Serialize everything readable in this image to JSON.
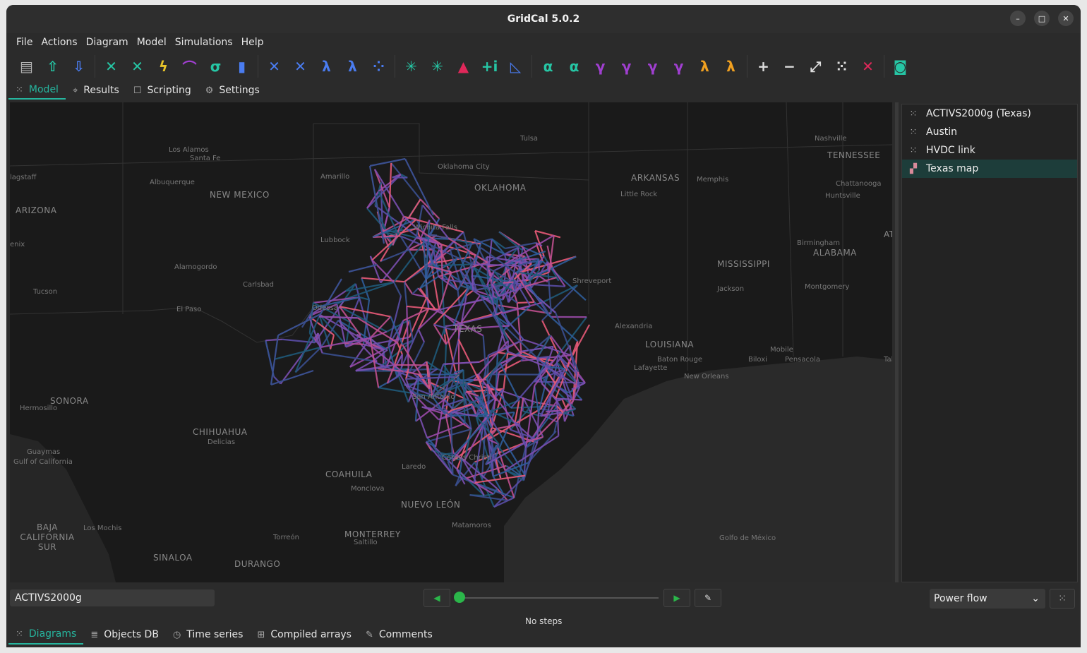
{
  "window": {
    "title": "GridCal 5.0.2",
    "min": "–",
    "max": "□",
    "close": "✕"
  },
  "menu": [
    "File",
    "Actions",
    "Diagram",
    "Model",
    "Simulations",
    "Help"
  ],
  "toolbar": {
    "groups": [
      [
        {
          "icon": "new-file-icon",
          "glyph": "▤",
          "color": "#b5b5b5"
        },
        {
          "icon": "upload-icon",
          "glyph": "⇧",
          "color": "#26c6a5"
        },
        {
          "icon": "download-icon",
          "glyph": "⇩",
          "color": "#4a7cf0"
        }
      ],
      [
        {
          "icon": "power-flow-icon",
          "glyph": "✕",
          "color": "#26c6a5"
        },
        {
          "icon": "optimal-power-flow-icon",
          "glyph": "✕",
          "color": "#26c6a5"
        },
        {
          "icon": "short-circuit-icon",
          "glyph": "ϟ",
          "color": "#e8c42a"
        },
        {
          "icon": "curve-icon",
          "glyph": "⌒",
          "color": "#a03fd0"
        },
        {
          "icon": "sigma-icon",
          "glyph": "σ",
          "color": "#26c6a5"
        },
        {
          "icon": "bar-chart-icon",
          "glyph": "▮",
          "color": "#4a7cf0"
        }
      ],
      [
        {
          "icon": "time-series-pf-icon",
          "glyph": "✕",
          "color": "#4a7cf0"
        },
        {
          "icon": "time-series-opf-icon",
          "glyph": "✕",
          "color": "#4a7cf0"
        },
        {
          "icon": "lambda-icon",
          "glyph": "λ",
          "color": "#4a7cf0"
        },
        {
          "icon": "lambda-bar-icon",
          "glyph": "λ",
          "color": "#4a7cf0"
        },
        {
          "icon": "clustering-icon",
          "glyph": "⁘",
          "color": "#4a7cf0"
        }
      ],
      [
        {
          "icon": "atc-icon",
          "glyph": "✳",
          "color": "#26c6a5"
        },
        {
          "icon": "atc-ts-icon",
          "glyph": "✳",
          "color": "#26c6a5"
        },
        {
          "icon": "triangle-icon",
          "glyph": "▲",
          "color": "#e0285a"
        },
        {
          "icon": "plus-i-icon",
          "glyph": "+i",
          "color": "#26c6a5"
        },
        {
          "icon": "line-chart-icon",
          "glyph": "◺",
          "color": "#4a7cf0"
        }
      ],
      [
        {
          "icon": "alpha-icon",
          "glyph": "α",
          "color": "#26c6a5"
        },
        {
          "icon": "alpha-bar-icon",
          "glyph": "α",
          "color": "#26c6a5"
        },
        {
          "icon": "gamma-icon",
          "glyph": "γ",
          "color": "#a03fd0"
        },
        {
          "icon": "gamma-dark-icon",
          "glyph": "γ",
          "color": "#a03fd0"
        },
        {
          "icon": "gamma-light-icon",
          "glyph": "γ",
          "color": "#a03fd0"
        },
        {
          "icon": "gamma-bar-icon",
          "glyph": "γ",
          "color": "#a03fd0"
        },
        {
          "icon": "lambda-orange-icon",
          "glyph": "λ",
          "color": "#f0a020"
        },
        {
          "icon": "lambda-orange-bar-icon",
          "glyph": "λ",
          "color": "#f0a020"
        }
      ],
      [
        {
          "icon": "add-icon",
          "glyph": "+",
          "color": "#dddddd"
        },
        {
          "icon": "remove-icon",
          "glyph": "−",
          "color": "#dddddd"
        },
        {
          "icon": "expand-icon",
          "glyph": "⤢",
          "color": "#dddddd"
        },
        {
          "icon": "network-icon",
          "glyph": "⁙",
          "color": "#dddddd"
        },
        {
          "icon": "delete-icon",
          "glyph": "✕",
          "color": "#e0285a"
        }
      ],
      [
        {
          "icon": "map-settings-icon",
          "glyph": "◙",
          "color": "#26c6a5"
        }
      ]
    ]
  },
  "top_tabs": [
    {
      "label": "Model",
      "icon": "model-icon",
      "glyph": "⁙",
      "active": true
    },
    {
      "label": "Results",
      "icon": "results-icon",
      "glyph": "⌖",
      "active": false
    },
    {
      "label": "Scripting",
      "icon": "scripting-icon",
      "glyph": "☐",
      "active": false
    },
    {
      "label": "Settings",
      "icon": "settings-icon",
      "glyph": "⚙",
      "active": false
    }
  ],
  "map_labels": [
    {
      "t": "Los Alamos",
      "big": false
    },
    {
      "t": "Santa Fe",
      "big": false
    },
    {
      "t": "Albuquerque",
      "big": false
    },
    {
      "t": "NEW MEXICO",
      "big": true
    },
    {
      "t": "ARIZONA",
      "big": true
    },
    {
      "t": "lagstaff",
      "big": false
    },
    {
      "t": "Amarillo",
      "big": false
    },
    {
      "t": "Tulsa",
      "big": false
    },
    {
      "t": "Oklahoma City",
      "big": false
    },
    {
      "t": "OKLAHOMA",
      "big": true
    },
    {
      "t": "ARKANSAS",
      "big": true
    },
    {
      "t": "Little Rock",
      "big": false
    },
    {
      "t": "Memphis",
      "big": false
    },
    {
      "t": "Nashville",
      "big": false
    },
    {
      "t": "TENNESSEE",
      "big": true
    },
    {
      "t": "Chattanooga",
      "big": false
    },
    {
      "t": "Huntsville",
      "big": false
    },
    {
      "t": "ATL",
      "big": true
    },
    {
      "t": "Lubbock",
      "big": false
    },
    {
      "t": "Wichita Falls",
      "big": false
    },
    {
      "t": "enix",
      "big": false
    },
    {
      "t": "Alamogordo",
      "big": false
    },
    {
      "t": "Carlsbad",
      "big": false
    },
    {
      "t": "Tucson",
      "big": false
    },
    {
      "t": "El Paso",
      "big": false
    },
    {
      "t": "Shreveport",
      "big": false
    },
    {
      "t": "MISSISSIPPI",
      "big": true
    },
    {
      "t": "Jackson",
      "big": false
    },
    {
      "t": "Birmingham",
      "big": false
    },
    {
      "t": "ALABAMA",
      "big": true
    },
    {
      "t": "Montgomery",
      "big": false
    },
    {
      "t": "Alexandria",
      "big": false
    },
    {
      "t": "LOUISIANA",
      "big": true
    },
    {
      "t": "Baton Rouge",
      "big": false
    },
    {
      "t": "Lafayette",
      "big": false
    },
    {
      "t": "New Orleans",
      "big": false
    },
    {
      "t": "Mobile",
      "big": false
    },
    {
      "t": "Biloxi",
      "big": false
    },
    {
      "t": "Pensacola",
      "big": false
    },
    {
      "t": "Talla",
      "big": false
    },
    {
      "t": "SONORA",
      "big": true
    },
    {
      "t": "Hermosillo",
      "big": false
    },
    {
      "t": "CHIHUAHUA",
      "big": true
    },
    {
      "t": "Delicias",
      "big": false
    },
    {
      "t": "Guaymas",
      "big": false
    },
    {
      "t": "Gulf of California",
      "big": false
    },
    {
      "t": "COAHUILA",
      "big": true
    },
    {
      "t": "Monclova",
      "big": false
    },
    {
      "t": "Laredo",
      "big": false
    },
    {
      "t": "NUEVO LEÓN",
      "big": true
    },
    {
      "t": "MONTERREY",
      "big": true
    },
    {
      "t": "Saltillo",
      "big": false
    },
    {
      "t": "Matamoros",
      "big": false
    },
    {
      "t": "BAJA CALIFORNIA SUR",
      "big": true
    },
    {
      "t": "Los Mochis",
      "big": false
    },
    {
      "t": "Torreón",
      "big": false
    },
    {
      "t": "SINALOA",
      "big": true
    },
    {
      "t": "DURANGO",
      "big": true
    },
    {
      "t": "Golfo de México",
      "big": false
    },
    {
      "t": "San Antonio",
      "big": false
    },
    {
      "t": "Corpus Christi",
      "big": false
    },
    {
      "t": "TEXAS",
      "big": true
    },
    {
      "t": "Odessa",
      "big": false
    }
  ],
  "diagrams": [
    {
      "label": "ACTIVS2000g (Texas)",
      "icon": "bus-branch-diagram-icon",
      "glyph": "⁙",
      "selected": false
    },
    {
      "label": "Austin",
      "icon": "bus-branch-diagram-icon",
      "glyph": "⁙",
      "selected": false
    },
    {
      "label": "HVDC link",
      "icon": "bus-branch-diagram-icon",
      "glyph": "⁙",
      "selected": false
    },
    {
      "label": "Texas map",
      "icon": "map-diagram-icon",
      "glyph": "▞",
      "selected": true
    }
  ],
  "bottom": {
    "grid_name": "ACTIVS2000g",
    "prev": "◀",
    "next": "▶",
    "edit": "✎",
    "steps_text": "No steps",
    "results_type": "Power flow",
    "dropdown_arrow": "⌄",
    "settings_glyph": "⁙"
  },
  "bottom_tabs": [
    {
      "label": "Diagrams",
      "icon": "diagrams-icon",
      "glyph": "⁙",
      "active": true
    },
    {
      "label": "Objects DB",
      "icon": "objects-db-icon",
      "glyph": "≣",
      "active": false
    },
    {
      "label": "Time series",
      "icon": "time-series-icon",
      "glyph": "◷",
      "active": false
    },
    {
      "label": "Compiled arrays",
      "icon": "compiled-arrays-icon",
      "glyph": "⊞",
      "active": false
    },
    {
      "label": "Comments",
      "icon": "comments-icon",
      "glyph": "✎",
      "active": false
    }
  ],
  "colors": {
    "accent": "#26b59e",
    "play": "#2bb64a",
    "grid_low": "#2f5d9a",
    "grid_mid": "#7a4fb0",
    "grid_high": "#e85a78"
  }
}
